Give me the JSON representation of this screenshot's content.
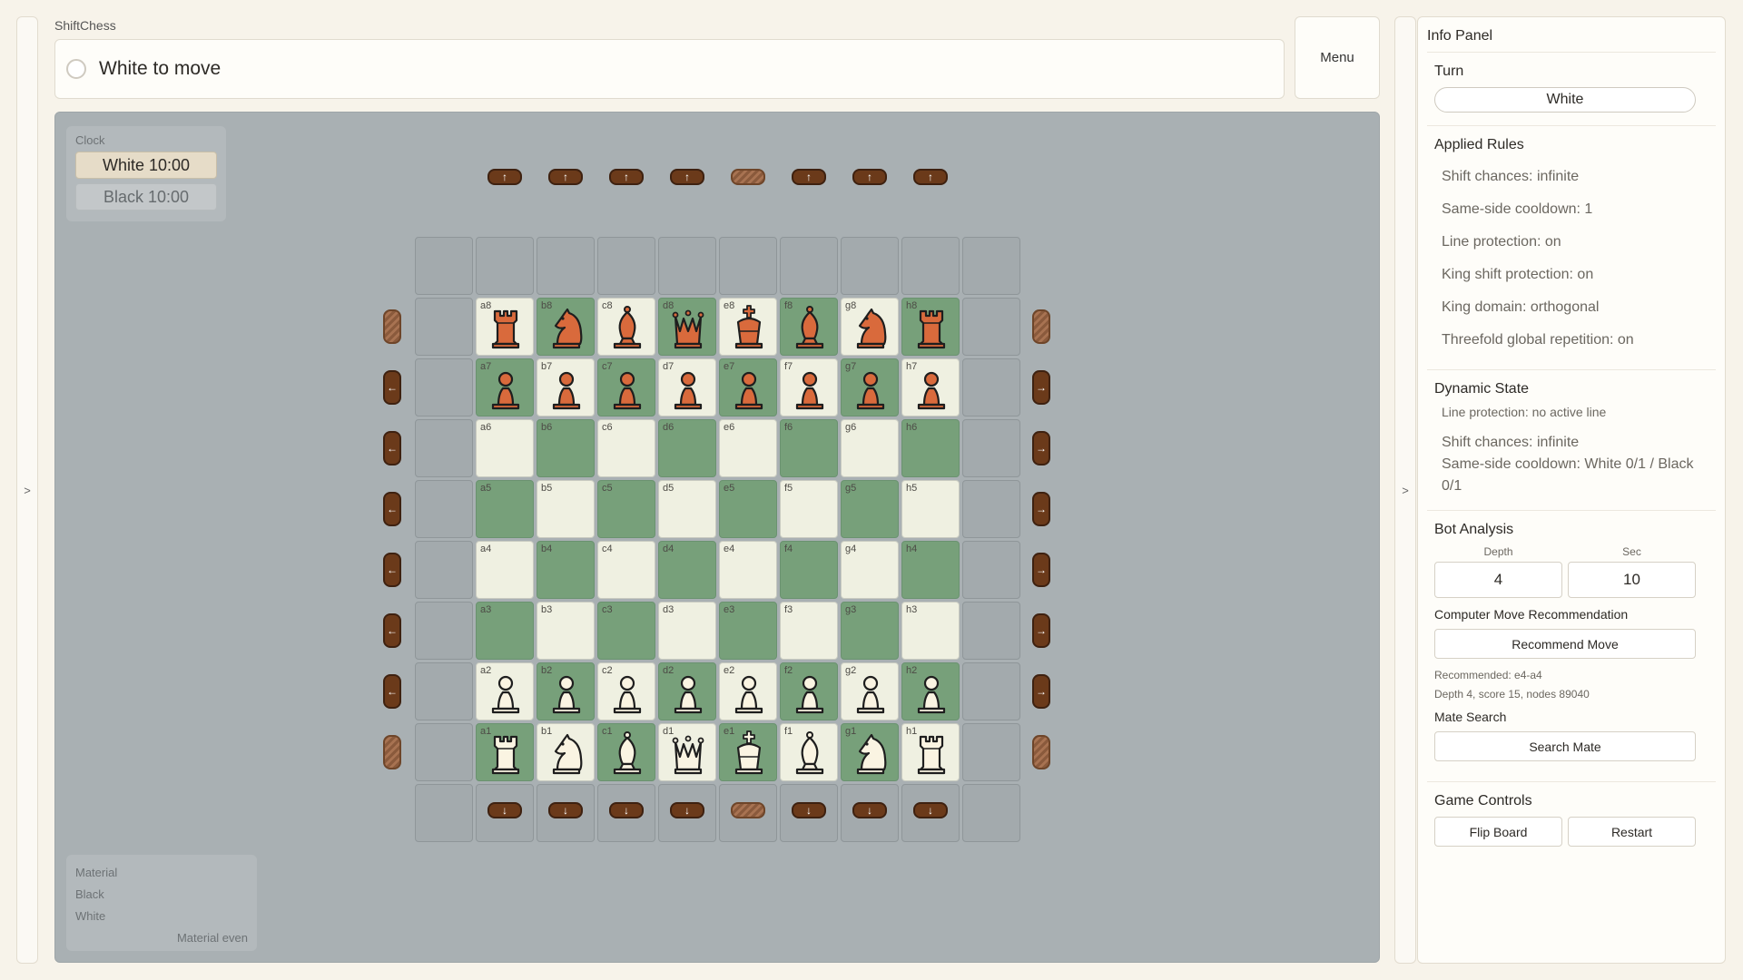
{
  "app": {
    "title": "ShiftChess",
    "status": "White to move",
    "menu_label": "Menu",
    "left_rail_glyph": ">",
    "info_rail_glyph": ">"
  },
  "clock": {
    "label": "Clock",
    "white": "White 10:00",
    "black": "Black 10:00"
  },
  "material": {
    "title": "Material",
    "black_label": "Black",
    "white_label": "White",
    "status": "Material even"
  },
  "board": {
    "files": [
      "a",
      "b",
      "c",
      "d",
      "e",
      "f",
      "g",
      "h"
    ],
    "ranks": [
      "8",
      "7",
      "6",
      "5",
      "4",
      "3",
      "2",
      "1"
    ],
    "position": [
      [
        "r",
        "n",
        "b",
        "q",
        "k",
        "b",
        "n",
        "r"
      ],
      [
        "p",
        "p",
        "p",
        "p",
        "p",
        "p",
        "p",
        "p"
      ],
      [
        "",
        "",
        "",
        "",
        "",
        "",
        "",
        ""
      ],
      [
        "",
        "",
        "",
        "",
        "",
        "",
        "",
        ""
      ],
      [
        "",
        "",
        "",
        "",
        "",
        "",
        "",
        ""
      ],
      [
        "",
        "",
        "",
        "",
        "",
        "",
        "",
        ""
      ],
      [
        "P",
        "P",
        "P",
        "P",
        "P",
        "P",
        "P",
        "P"
      ],
      [
        "R",
        "N",
        "B",
        "Q",
        "K",
        "B",
        "N",
        "R"
      ]
    ],
    "shift_controls": {
      "top": [
        "↑",
        "↑",
        "↑",
        "↑",
        "",
        "↑",
        "↑",
        "↑"
      ],
      "bottom": [
        "↓",
        "↓",
        "↓",
        "↓",
        "",
        "↓",
        "↓",
        "↓"
      ],
      "left": [
        "",
        "←",
        "←",
        "←",
        "←",
        "←",
        "←",
        ""
      ],
      "right": [
        "",
        "→",
        "→",
        "→",
        "→",
        "→",
        "→",
        ""
      ]
    },
    "colors": {
      "light": "#eff0e1",
      "dark": "#77a07a",
      "white_piece": "#faf4e2",
      "black_piece": "#d96a3c",
      "outline": "#1e1e1e"
    }
  },
  "info": {
    "title": "Info Panel",
    "turn": {
      "title": "Turn",
      "value": "White"
    },
    "rules": {
      "title": "Applied Rules",
      "items": [
        "Shift chances: infinite",
        "Same-side cooldown: 1",
        "Line protection: on",
        "King shift protection: on",
        "King domain: orthogonal",
        "Threefold global repetition: on"
      ]
    },
    "dynamic": {
      "title": "Dynamic State",
      "line_protection": "Line protection: no active line",
      "shift_chances": "Shift chances: infinite",
      "cooldown": "Same-side cooldown: White 0/1 / Black 0/1"
    },
    "bot": {
      "title": "Bot Analysis",
      "depth_label": "Depth",
      "sec_label": "Sec",
      "depth_value": "4",
      "sec_value": "10",
      "recommend_title": "Computer Move Recommendation",
      "recommend_button": "Recommend Move",
      "recommended": "Recommended: e4-a4",
      "details": "Depth 4, score 15, nodes 89040",
      "mate_title": "Mate Search",
      "mate_button": "Search Mate"
    },
    "controls": {
      "title": "Game Controls",
      "flip": "Flip Board",
      "restart": "Restart"
    }
  }
}
